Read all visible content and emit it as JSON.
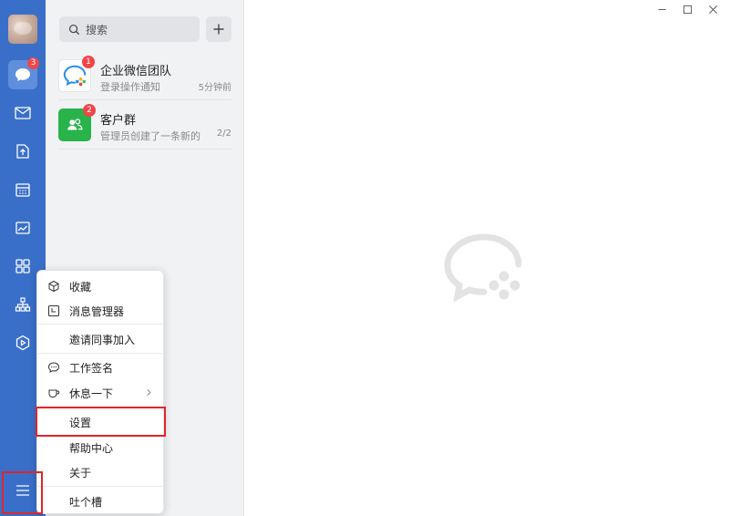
{
  "colors": {
    "rail": "#3a6fc9",
    "accent": "#3a6fc9",
    "badge": "#f0464a",
    "highlight": "#e0262b"
  },
  "rail": {
    "chat_badge": "3",
    "icons": [
      "avatar",
      "chat-icon",
      "mail-icon",
      "docs-icon",
      "calendar-icon",
      "workbench-icon",
      "apps-icon",
      "org-icon",
      "mini-program-icon",
      "menu-icon"
    ]
  },
  "search": {
    "placeholder": "搜索"
  },
  "conversations": [
    {
      "name": "企业微信团队",
      "subtitle": "登录操作通知",
      "meta": "5分钟前",
      "badge": "1",
      "icon": "wecom-team-icon"
    },
    {
      "name": "客户群",
      "subtitle": "管理员创建了一条新的…",
      "meta": "2/2",
      "badge": "2",
      "icon": "customer-group-icon"
    }
  ],
  "menu": {
    "items": [
      {
        "label": "收藏",
        "icon": "cube-icon"
      },
      {
        "label": "消息管理器",
        "icon": "message-manager-icon"
      },
      {
        "label": "邀请同事加入",
        "icon": ""
      },
      {
        "label": "工作签名",
        "icon": "speech-bubble-icon"
      },
      {
        "label": "休息一下",
        "icon": "coffee-cup-icon",
        "has_submenu": true
      },
      {
        "label": "设置",
        "icon": "",
        "highlighted": true
      },
      {
        "label": "帮助中心",
        "icon": ""
      },
      {
        "label": "关于",
        "icon": ""
      },
      {
        "label": "吐个槽",
        "icon": ""
      }
    ]
  },
  "window": {
    "controls": [
      "minimize-icon",
      "maximize-icon",
      "close-icon"
    ]
  }
}
